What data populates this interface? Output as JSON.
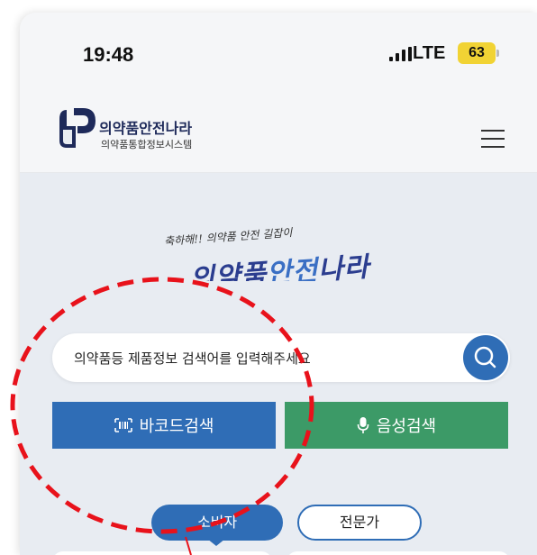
{
  "status_bar": {
    "time": "19:48",
    "network": "LTE",
    "battery": "63"
  },
  "header": {
    "brand_main": "의약품안전나라",
    "brand_sub": "의약품통합정보시스템",
    "menu_icon": "hamburger-icon"
  },
  "banner": {
    "slogan_small": "축하해!! 의약품 안전 길잡이",
    "slogan_big_a": "의약품",
    "slogan_big_b": "안전",
    "slogan_big_c": "나라"
  },
  "search": {
    "placeholder": "의약품등 제품정보 검색어를 입력해주세요",
    "search_icon": "search-icon"
  },
  "buttons": {
    "barcode_label": "바코드검색",
    "voice_label": "음성검색"
  },
  "tabs": {
    "consumer": "소비자",
    "professional": "전문가"
  },
  "colors": {
    "primary_blue": "#2f6db6",
    "voice_green": "#3c9a67",
    "annotation_red": "#e8121b",
    "battery_yellow": "#f1d334"
  }
}
